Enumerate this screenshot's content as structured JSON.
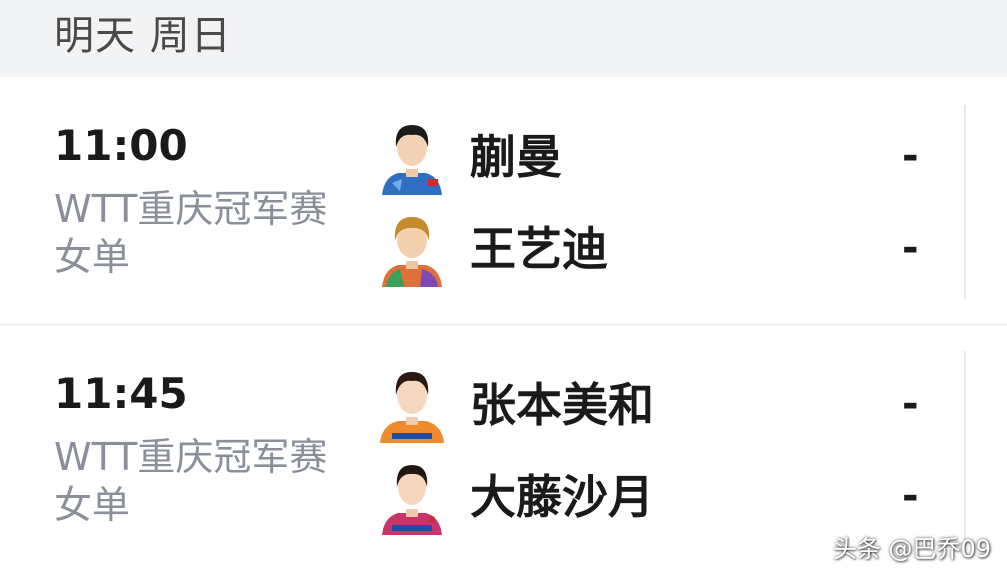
{
  "day_header": {
    "title": "明天 周日"
  },
  "matches": [
    {
      "time": "11:00",
      "event_line1": "WTT重庆冠军赛",
      "event_line2": "女单",
      "players": [
        {
          "name": "蒯曼",
          "score": "-",
          "avatar_icon": "player-avatar-blue-jersey",
          "jersey_color": "#2f6fc1",
          "hair_color": "#1b1b1b"
        },
        {
          "name": "王艺迪",
          "score": "-",
          "avatar_icon": "player-avatar-multicolor-jersey",
          "jersey_color": "#e0703a",
          "hair_color": "#c48a2c"
        }
      ]
    },
    {
      "time": "11:45",
      "event_line1": "WTT重庆冠军赛",
      "event_line2": "女单",
      "players": [
        {
          "name": "张本美和",
          "score": "-",
          "avatar_icon": "player-avatar-orange-jersey",
          "jersey_color": "#f08a2a",
          "hair_color": "#2a1a12"
        },
        {
          "name": "大藤沙月",
          "score": "-",
          "avatar_icon": "player-avatar-pink-jersey",
          "jersey_color": "#c9356a",
          "hair_color": "#241712"
        }
      ]
    }
  ],
  "watermark": "头条 @巴乔09"
}
